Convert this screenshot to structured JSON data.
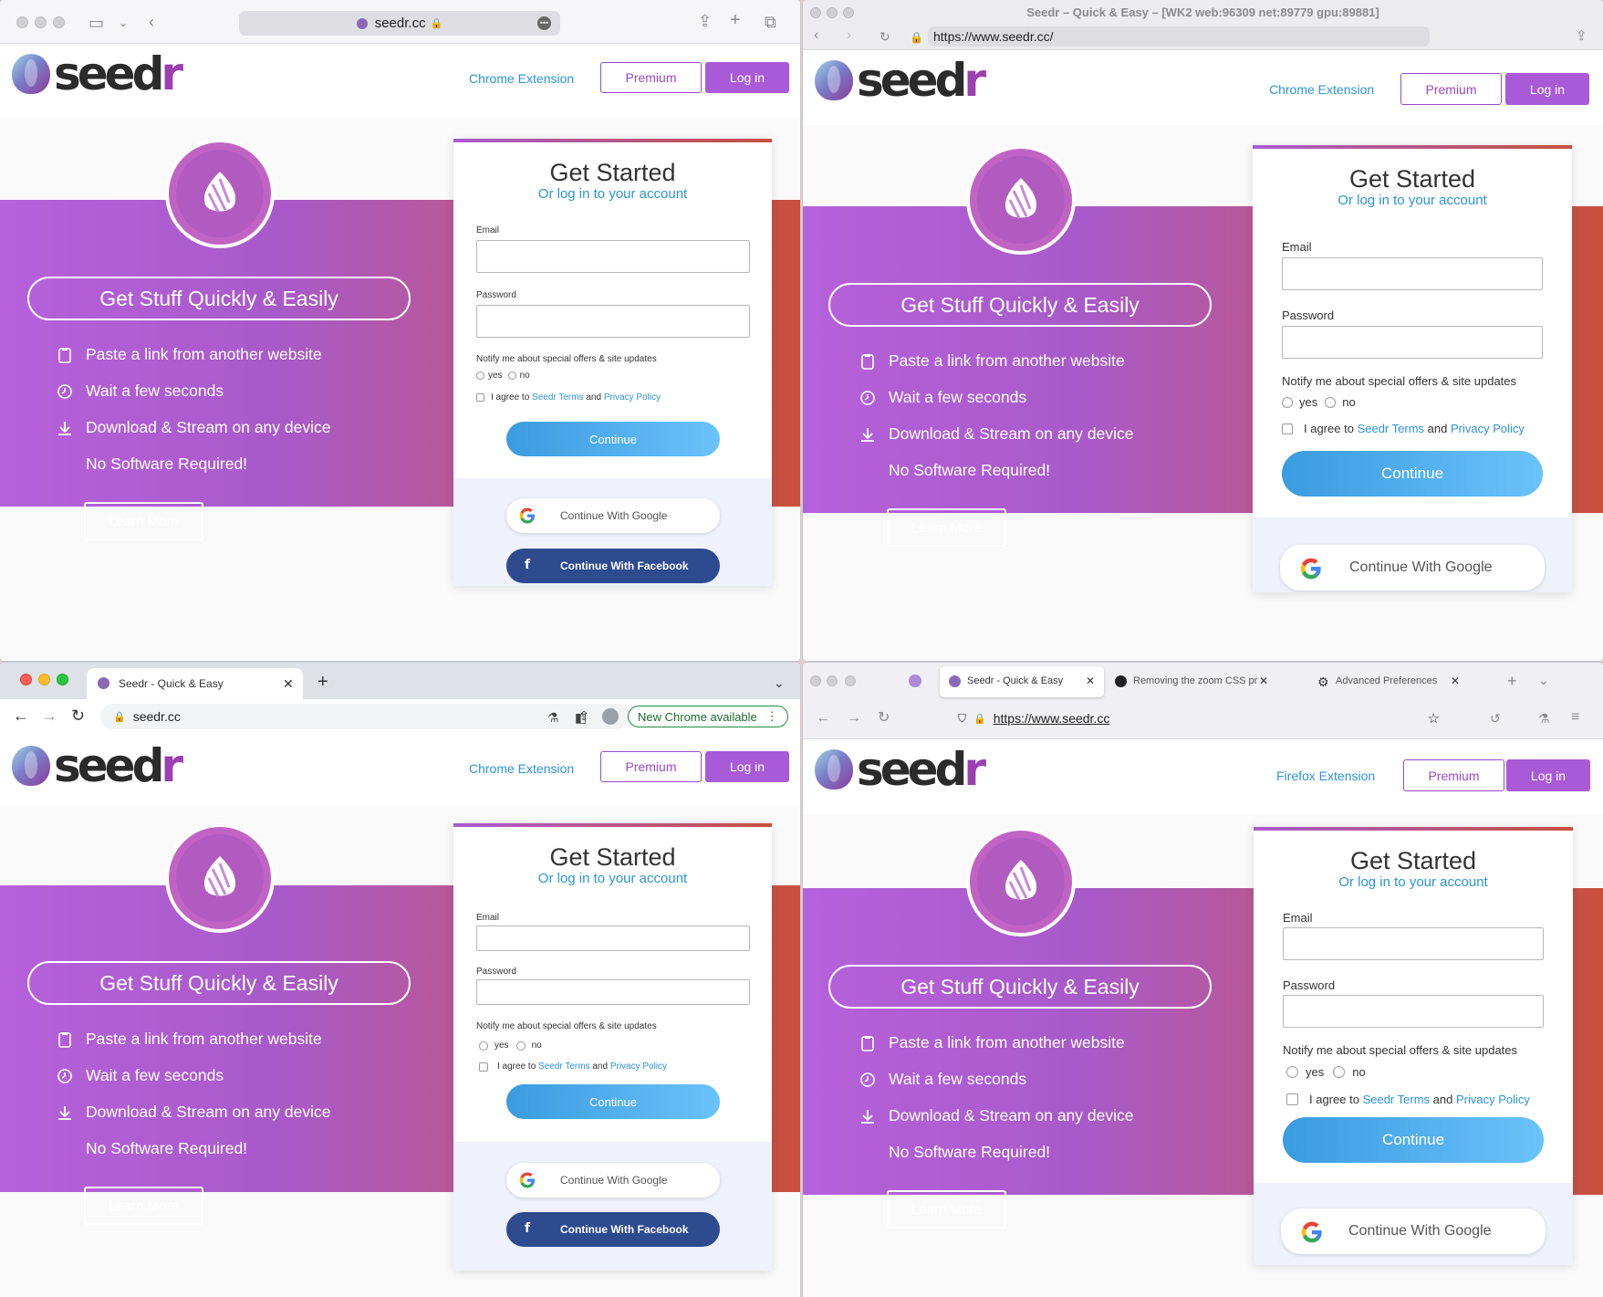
{
  "browsers": {
    "safari": {
      "url_host": "seedr.cc"
    },
    "webkit": {
      "window_title": "Seedr – Quick & Easy – [WK2 web:96309 net:89779 gpu:89881]",
      "url": "https://www.seedr.cc/"
    },
    "chrome": {
      "tab_title": "Seedr - Quick & Easy",
      "url": "seedr.cc",
      "update_label": "New Chrome available"
    },
    "firefox": {
      "tabs": [
        {
          "label": "Seedr - Quick & Easy"
        },
        {
          "label": "Removing the zoom CSS pr"
        },
        {
          "label": "Advanced Preferences"
        }
      ],
      "url": "https://www.seedr.cc"
    }
  },
  "site": {
    "logo_text_main": "seed",
    "logo_text_end": "r",
    "nav": {
      "chrome_extension": "Chrome Extension",
      "firefox_extension": "Firefox Extension",
      "premium": "Premium",
      "login": "Log in"
    },
    "hero": {
      "tagline": "Get Stuff Quickly & Easily",
      "features": [
        {
          "icon": "clipboard-icon",
          "text": "Paste a link from another website"
        },
        {
          "icon": "clock-icon",
          "text": "Wait a few seconds"
        },
        {
          "icon": "download-icon",
          "text": "Download & Stream on any device"
        },
        {
          "icon": "none",
          "text": "No Software Required!"
        }
      ],
      "learn_more": "Learn More"
    },
    "signup": {
      "title": "Get Started",
      "subtitle": "Or log in to your account",
      "email_label": "Email",
      "password_label": "Password",
      "notify_label": "Notify me about special offers & site updates",
      "yes": "yes",
      "no": "no",
      "agree_prefix": "I agree to",
      "terms_link": "Seedr Terms",
      "and": "and",
      "privacy_link": "Privacy Policy",
      "continue": "Continue",
      "google": "Continue With Google",
      "facebook": "Continue With Facebook"
    },
    "colors": {
      "accent": "#a95ad6",
      "link": "#2c93d8",
      "facebook": "#2e4b8f"
    }
  }
}
